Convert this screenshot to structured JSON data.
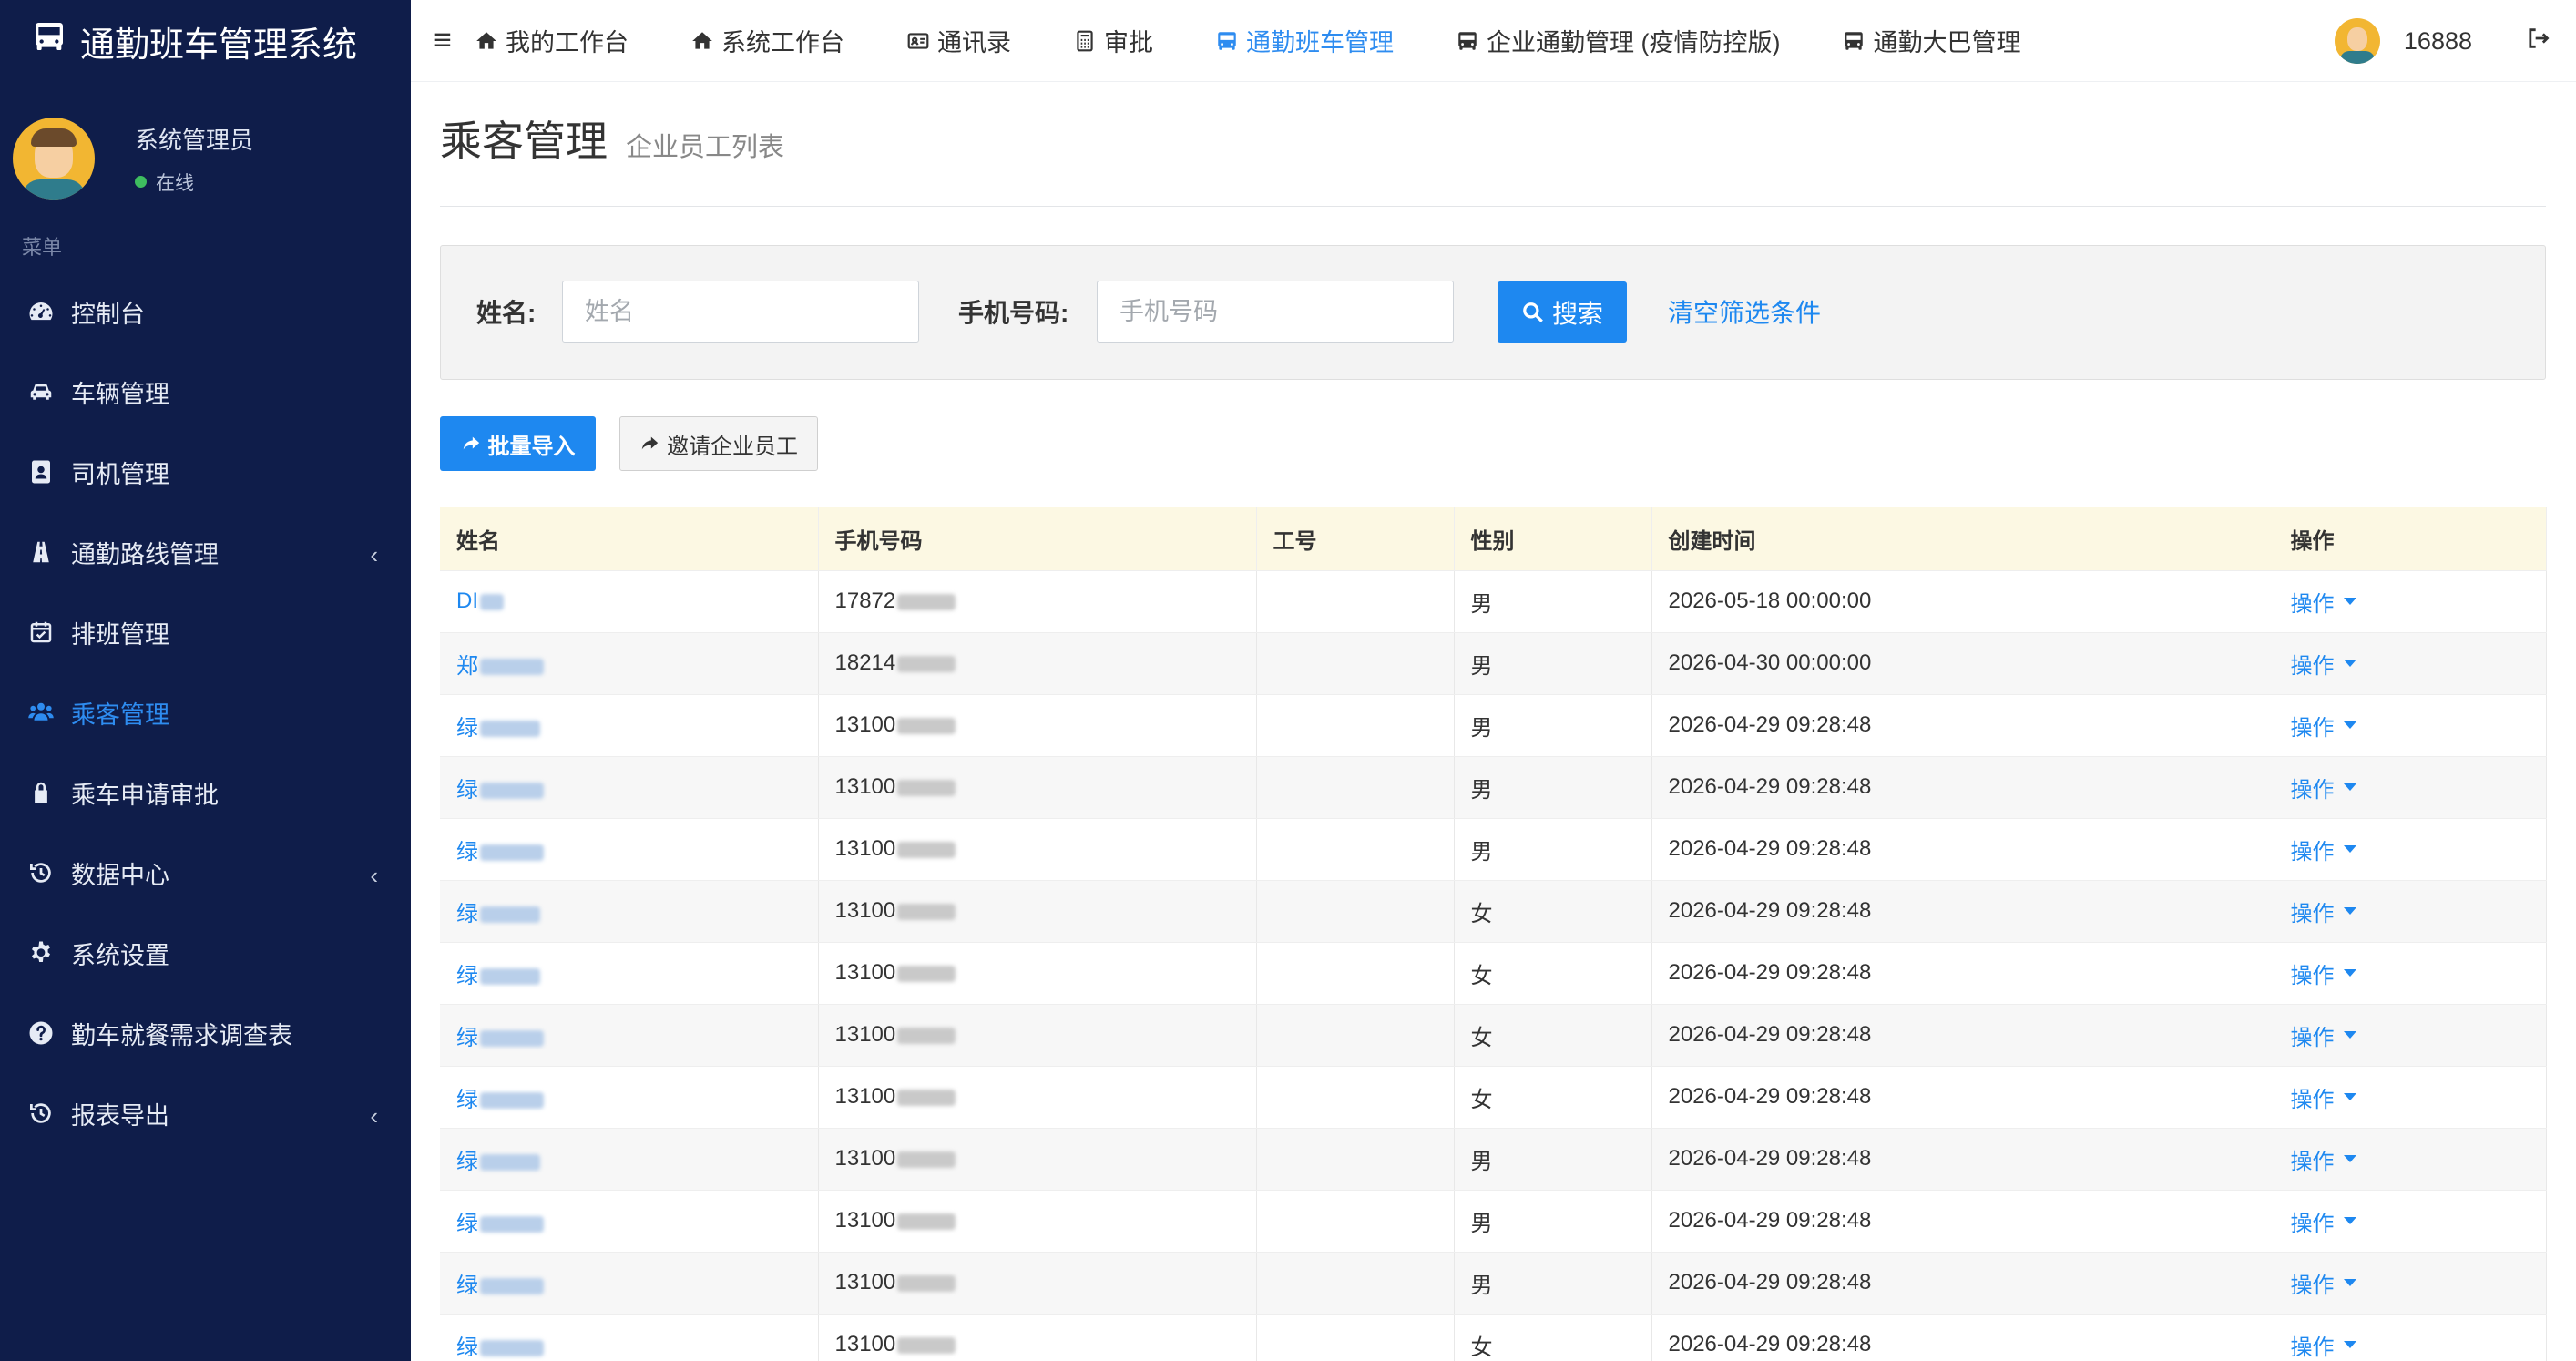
{
  "app": {
    "title": "通勤班车管理系统"
  },
  "user": {
    "name": "系统管理员",
    "status": "在线",
    "account": "16888"
  },
  "sidebar": {
    "menu_header": "菜单",
    "items": [
      {
        "label": "控制台",
        "icon": "dashboard-icon"
      },
      {
        "label": "车辆管理",
        "icon": "car-icon"
      },
      {
        "label": "司机管理",
        "icon": "address-book-icon"
      },
      {
        "label": "通勤路线管理",
        "icon": "road-icon"
      },
      {
        "label": "排班管理",
        "icon": "calendar-icon"
      },
      {
        "label": "乘客管理",
        "icon": "users-icon"
      },
      {
        "label": "乘车申请审批",
        "icon": "lock-icon"
      },
      {
        "label": "数据中心",
        "icon": "history-icon"
      },
      {
        "label": "系统设置",
        "icon": "gear-icon"
      },
      {
        "label": "勤车就餐需求调查表",
        "icon": "question-circle-icon"
      },
      {
        "label": "报表导出",
        "icon": "history-icon"
      }
    ]
  },
  "topnav": {
    "items": [
      {
        "label": "我的工作台",
        "icon": "home-icon"
      },
      {
        "label": "系统工作台",
        "icon": "home-icon"
      },
      {
        "label": "通讯录",
        "icon": "id-card-icon"
      },
      {
        "label": "审批",
        "icon": "calculator-icon"
      },
      {
        "label": "通勤班车管理",
        "icon": "bus-icon"
      },
      {
        "label": "企业通勤管理 (疫情防控版)",
        "icon": "bus-icon"
      },
      {
        "label": "通勤大巴管理",
        "icon": "bus-icon"
      }
    ]
  },
  "page": {
    "title": "乘客管理",
    "subtitle": "企业员工列表"
  },
  "filters": {
    "name_label": "姓名:",
    "name_placeholder": "姓名",
    "phone_label": "手机号码:",
    "phone_placeholder": "手机号码",
    "search_label": "搜索",
    "clear_label": "清空筛选条件"
  },
  "actions": {
    "import_label": "批量导入",
    "invite_label": "邀请企业员工"
  },
  "table": {
    "headers": [
      "姓名",
      "手机号码",
      "工号",
      "性别",
      "创建时间",
      "操作"
    ],
    "op_label": "操作",
    "rows": [
      {
        "name": "DI",
        "phone": "17872",
        "emp_no": "",
        "gender": "男",
        "created": "2026-05-18 00:00:00"
      },
      {
        "name": "郑",
        "phone": "18214",
        "emp_no": "",
        "gender": "男",
        "created": "2026-04-30 00:00:00"
      },
      {
        "name": "绿",
        "phone": "13100",
        "emp_no": "",
        "gender": "男",
        "created": "2026-04-29 09:28:48"
      },
      {
        "name": "绿",
        "phone": "13100",
        "emp_no": "",
        "gender": "男",
        "created": "2026-04-29 09:28:48"
      },
      {
        "name": "绿",
        "phone": "13100",
        "emp_no": "",
        "gender": "男",
        "created": "2026-04-29 09:28:48"
      },
      {
        "name": "绿",
        "phone": "13100",
        "emp_no": "",
        "gender": "女",
        "created": "2026-04-29 09:28:48"
      },
      {
        "name": "绿",
        "phone": "13100",
        "emp_no": "",
        "gender": "女",
        "created": "2026-04-29 09:28:48"
      },
      {
        "name": "绿",
        "phone": "13100",
        "emp_no": "",
        "gender": "女",
        "created": "2026-04-29 09:28:48"
      },
      {
        "name": "绿",
        "phone": "13100",
        "emp_no": "",
        "gender": "女",
        "created": "2026-04-29 09:28:48"
      },
      {
        "name": "绿",
        "phone": "13100",
        "emp_no": "",
        "gender": "男",
        "created": "2026-04-29 09:28:48"
      },
      {
        "name": "绿",
        "phone": "13100",
        "emp_no": "",
        "gender": "男",
        "created": "2026-04-29 09:28:48"
      },
      {
        "name": "绿",
        "phone": "13100",
        "emp_no": "",
        "gender": "男",
        "created": "2026-04-29 09:28:48"
      },
      {
        "name": "绿",
        "phone": "13100",
        "emp_no": "",
        "gender": "女",
        "created": "2026-04-29 09:28:48"
      }
    ]
  },
  "colors": {
    "sidebar_bg": "#0f1d4a",
    "accent": "#1e88f0",
    "table_header_bg": "#fcf8e3",
    "online": "#3ebd5f"
  }
}
